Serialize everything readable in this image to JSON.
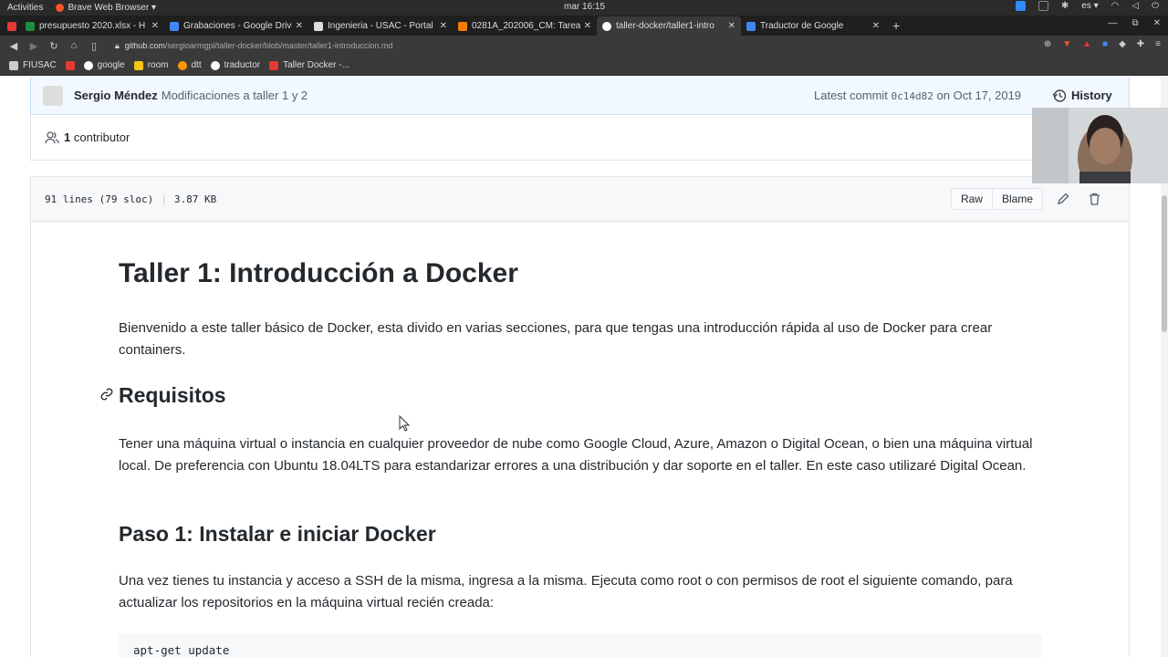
{
  "system": {
    "activities": "Activities",
    "app_name": "Brave Web Browser ▾",
    "clock": "mar 16:15",
    "lang": "es ▾"
  },
  "tabs": [
    {
      "title": "presupuesto 2020.xlsx - H",
      "color": "#1e8e3e"
    },
    {
      "title": "Grabaciones - Google Drive",
      "color": "#4285f4"
    },
    {
      "title": "Ingenieria - USAC - Portal",
      "color": "#444444"
    },
    {
      "title": "0281A_202006_CM: Tarea",
      "color": "#f57c00"
    },
    {
      "title": "taller-docker/taller1-intro",
      "color": "#ffffff"
    },
    {
      "title": "Traductor de Google",
      "color": "#4285f4"
    }
  ],
  "address": {
    "host": "github.com",
    "path": "/sergioarmgpl/taller-docker/blob/master/taller1-introduccion.md"
  },
  "bookmarks": [
    {
      "label": "FIUSAC",
      "color": "#cccccc"
    },
    {
      "label": "",
      "color": "#e53935"
    },
    {
      "label": "google",
      "color": "#ffffff"
    },
    {
      "label": "room",
      "color": "#f5c518"
    },
    {
      "label": "dtt",
      "color": "#ff9800"
    },
    {
      "label": "traductor",
      "color": "#ffffff"
    },
    {
      "label": "Taller Docker -...",
      "color": "#e53935"
    }
  ],
  "commit": {
    "author": "Sergio Méndez",
    "message": "Modificaciones a taller 1 y 2",
    "latest_prefix": "Latest commit",
    "sha": "0c14d82",
    "date": "on Oct 17, 2019",
    "history": "History"
  },
  "contributors": {
    "count": "1",
    "label": "contributor"
  },
  "file": {
    "lines": "91 lines (79 sloc)",
    "size": "3.87 KB",
    "raw": "Raw",
    "blame": "Blame"
  },
  "readme": {
    "title": "Taller 1: Introducción a Docker",
    "intro": "Bienvenido a este taller básico de Docker, esta divido en varias secciones, para que tengas una introducción rápida al uso de Docker para crear containers.",
    "req_heading": "Requisitos",
    "req_text": "Tener una máquina virtual o instancia en cualquier proveedor de nube como Google Cloud, Azure, Amazon o Digital Ocean, o bien una máquina virtual local. De preferencia con Ubuntu 18.04LTS para estandarizar errores a una distribución y dar soporte en el taller. En este caso utilizaré Digital Ocean.",
    "step1_heading": "Paso 1: Instalar e iniciar Docker",
    "step1_text": "Una vez tienes tu instancia y acceso a SSH de la misma, ingresa a la misma. Ejecuta como root o con permisos de root el siguiente comando, para actualizar los repositorios en la máquina virtual recién creada:",
    "code": "apt-get update"
  }
}
